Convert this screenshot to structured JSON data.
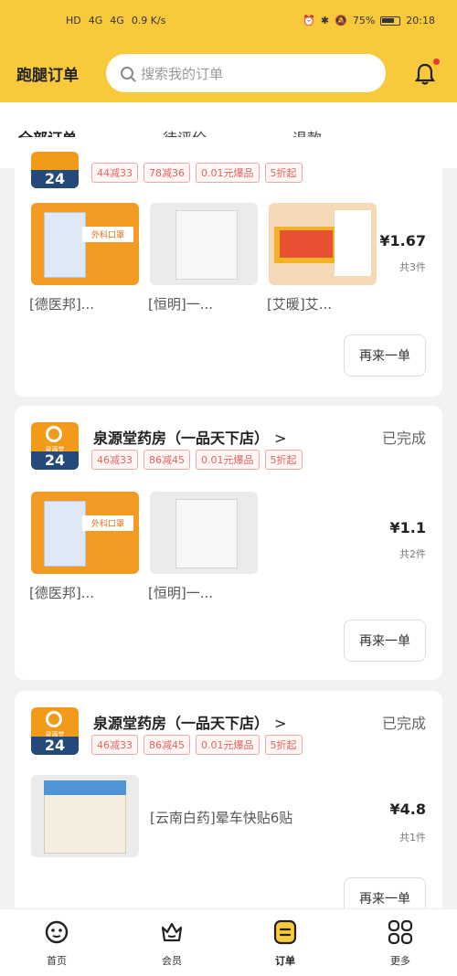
{
  "status_bar": {
    "network_left": "HD",
    "signal_1": "4G",
    "signal_2": "4G",
    "speed": "0.9 K/s",
    "battery": "75%",
    "time": "20:18"
  },
  "header": {
    "title": "跑腿订单",
    "search_placeholder": "搜索我的订单",
    "accent_color": "#f9c93c"
  },
  "tabs": [
    {
      "label": "全部订单",
      "active": true
    },
    {
      "label": "待评价",
      "active": false
    },
    {
      "label": "退款",
      "active": false
    }
  ],
  "orders": [
    {
      "coupons": [
        "44减33",
        "78减36",
        "0.01元爆品",
        "5折起"
      ],
      "items": [
        {
          "caption": "[德医邦]..."
        },
        {
          "caption": "[恒明]一..."
        },
        {
          "caption": "[艾暖]艾..."
        }
      ],
      "price": "¥1.67",
      "count": "共3件",
      "button": "再来一单"
    },
    {
      "store": "泉源堂药房（一品天下店）",
      "arrow": ">",
      "status": "已完成",
      "coupons": [
        "46减33",
        "86减45",
        "0.01元爆品",
        "5折起"
      ],
      "items": [
        {
          "caption": "[德医邦]..."
        },
        {
          "caption": "[恒明]一..."
        }
      ],
      "price": "¥1.1",
      "count": "共2件",
      "button": "再来一单"
    },
    {
      "store": "泉源堂药房（一品天下店）",
      "arrow": ">",
      "status": "已完成",
      "coupons": [
        "46减33",
        "86减45",
        "0.01元爆品",
        "5折起"
      ],
      "items": [
        {
          "caption": "[云南白药]晕车快贴6贴"
        }
      ],
      "price": "¥4.8",
      "count": "共1件",
      "button": "再来一单"
    }
  ],
  "store_logo": {
    "badge": "24",
    "small_text": "泉源堂"
  },
  "bottom_nav": [
    {
      "label": "首页",
      "icon": "home-icon"
    },
    {
      "label": "会员",
      "icon": "member-crown-icon"
    },
    {
      "label": "订单",
      "icon": "order-icon",
      "active": true
    },
    {
      "label": "更多",
      "icon": "more-grid-icon"
    }
  ]
}
